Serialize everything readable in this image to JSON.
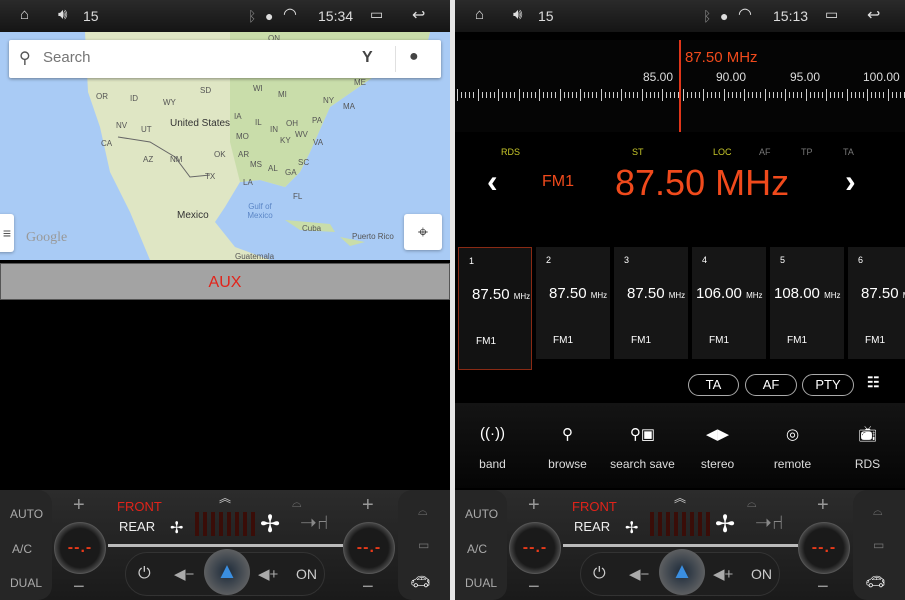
{
  "left": {
    "status": {
      "volume": "15",
      "time": "15:34"
    },
    "map": {
      "search_placeholder": "Search",
      "labels": {
        "us": "United States",
        "mexico": "Mexico",
        "gulf": "Gulf of Mexico",
        "cuba": "Cuba",
        "pr": "Puerto Rico",
        "guatemala": "Guatemala",
        "or": "OR",
        "id": "ID",
        "wy": "WY",
        "sd": "SD",
        "wi": "WI",
        "mi": "MI",
        "ny": "NY",
        "ma": "MA",
        "me": "ME",
        "ia": "IA",
        "il": "IL",
        "in": "IN",
        "oh": "OH",
        "pa": "PA",
        "nv": "NV",
        "ut": "UT",
        "ca": "CA",
        "mo": "MO",
        "ky": "KY",
        "wv": "WV",
        "va": "VA",
        "az": "AZ",
        "nm": "NM",
        "ok": "OK",
        "ar": "AR",
        "ms": "MS",
        "al": "AL",
        "ga": "GA",
        "sc": "SC",
        "tx": "TX",
        "la": "LA",
        "fl": "FL",
        "on": "ON"
      },
      "logo": "Google"
    },
    "aux_label": "AUX"
  },
  "right": {
    "status": {
      "volume": "15",
      "time": "15:13"
    },
    "scale": {
      "current": "87.50 MHz",
      "ticks": [
        "85.00",
        "90.00",
        "95.00",
        "100.00"
      ]
    },
    "indicators": {
      "rds": "RDS",
      "st": "ST",
      "loc": "LOC",
      "af": "AF",
      "tp": "TP",
      "ta": "TA"
    },
    "band": "FM1",
    "frequency": "87.50 MHz",
    "presets": [
      {
        "n": "1",
        "f": "87.50",
        "u": "MHz",
        "b": "FM1"
      },
      {
        "n": "2",
        "f": "87.50",
        "u": "MHz",
        "b": "FM1"
      },
      {
        "n": "3",
        "f": "87.50",
        "u": "MHz",
        "b": "FM1"
      },
      {
        "n": "4",
        "f": "106.00",
        "u": "MHz",
        "b": "FM1"
      },
      {
        "n": "5",
        "f": "108.00",
        "u": "MHz",
        "b": "FM1"
      },
      {
        "n": "6",
        "f": "87.50",
        "u": "MHz",
        "b": "FM1"
      }
    ],
    "selected_preset": 1,
    "pills": [
      "TA",
      "AF",
      "PTY"
    ],
    "functions": [
      {
        "label": "band",
        "icon": "band-icon"
      },
      {
        "label": "browse",
        "icon": "search-icon"
      },
      {
        "label": "search save",
        "icon": "search-save-icon"
      },
      {
        "label": "stereo",
        "icon": "stereo-icon"
      },
      {
        "label": "remote",
        "icon": "loc-icon"
      },
      {
        "label": "RDS",
        "icon": "tv-antenna-icon"
      }
    ]
  },
  "climate": {
    "auto": "AUTO",
    "ac": "A/C",
    "dual": "DUAL",
    "front": "FRONT",
    "rear": "REAR",
    "temp_left": "--.-",
    "temp_right": "--.-",
    "on": "ON",
    "fan_level": 0,
    "colors": {
      "front": "#e2231a",
      "temp": "#e83a1a"
    }
  },
  "colors": {
    "accent": "#f04a1c",
    "indicator_on": "#c8c82a",
    "indicator_off": "#777777"
  }
}
